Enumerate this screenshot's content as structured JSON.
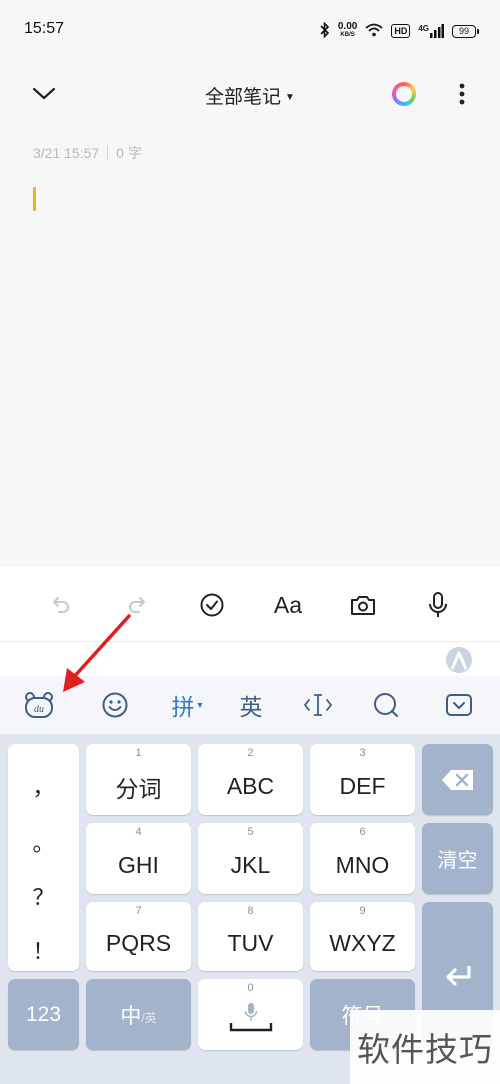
{
  "status_bar": {
    "time": "15:57",
    "net_speed_value": "0.00",
    "net_speed_unit": "KB/S",
    "hd": "HD",
    "network": "4G",
    "battery": "99"
  },
  "header": {
    "title": "全部笔记",
    "icons": [
      "chevron-down-icon",
      "color-ring-icon",
      "more-vertical-icon"
    ]
  },
  "note": {
    "date": "3/21 15:57",
    "word_count": "0 字"
  },
  "editor_toolbar": {
    "icons": [
      "undo-icon",
      "redo-icon",
      "checklist-icon",
      "text-format-icon",
      "camera-icon",
      "microphone-icon"
    ],
    "text_format_label": "Aa"
  },
  "ime_bar": {
    "pinyin_label": "拼",
    "english_label": "英",
    "icons": [
      "baidu-du-icon",
      "emoji-icon",
      "cursor-move-icon",
      "search-icon",
      "keyboard-collapse-icon"
    ]
  },
  "keyboard": {
    "punctuation": [
      "，",
      "。",
      "？",
      "！"
    ],
    "keys": [
      {
        "num": "1",
        "label": "分词"
      },
      {
        "num": "2",
        "label": "ABC"
      },
      {
        "num": "3",
        "label": "DEF"
      },
      {
        "num": "4",
        "label": "GHI"
      },
      {
        "num": "5",
        "label": "JKL"
      },
      {
        "num": "6",
        "label": "MNO"
      },
      {
        "num": "7",
        "label": "PQRS"
      },
      {
        "num": "8",
        "label": "TUV"
      },
      {
        "num": "9",
        "label": "WXYZ"
      }
    ],
    "clear_label": "清空",
    "num_mode_label": "123",
    "zh_label": "中",
    "zh_sub_label": "/英",
    "space_num": "0",
    "symbol_label": "符号"
  },
  "watermark": "软件技巧",
  "colors": {
    "accent_blue": "#3a78c9",
    "cursor_yellow": "#e2b826",
    "arrow_red": "#e02020",
    "func_key": "#a3b3cc"
  }
}
